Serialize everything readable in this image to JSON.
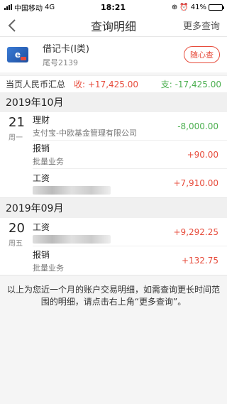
{
  "statusbar": {
    "carrier": "中国移动",
    "network": "4G",
    "time": "18:21",
    "battery": "41%",
    "battery_level": 0.41
  },
  "nav": {
    "title": "查询明细",
    "more": "更多查询"
  },
  "card": {
    "name": "借记卡(Ⅰ类)",
    "tail": "尾号2139",
    "query_btn": "随心查",
    "icon_text": "e"
  },
  "summary": {
    "label": "当页人民币汇总",
    "income": "收: +17,425.00",
    "expense": "支: -17,425.00"
  },
  "months": [
    {
      "label": "2019年10月",
      "day": "21",
      "weekday": "周一",
      "txs": [
        {
          "name": "理财",
          "sub": "支付宝-中欧基金管理有限公司",
          "amount": "-8,000.00",
          "kind": "neg"
        },
        {
          "name": "报销",
          "sub": "批量业务",
          "amount": "+90.00",
          "kind": "pos"
        },
        {
          "name": "工资",
          "sub": "",
          "amount": "+7,910.00",
          "kind": "pos"
        }
      ]
    },
    {
      "label": "2019年09月",
      "day": "20",
      "weekday": "周五",
      "txs": [
        {
          "name": "工资",
          "sub": "",
          "amount": "+9,292.25",
          "kind": "pos"
        },
        {
          "name": "报销",
          "sub": "批量业务",
          "amount": "+132.75",
          "kind": "pos"
        }
      ]
    }
  ],
  "footnote": "以上为您近一个月的账户交易明细，如需查询更长时间范围的明细，请点击右上角“更多查询”。",
  "colors": {
    "income": "#e74c3c",
    "expense": "#4caf50"
  }
}
